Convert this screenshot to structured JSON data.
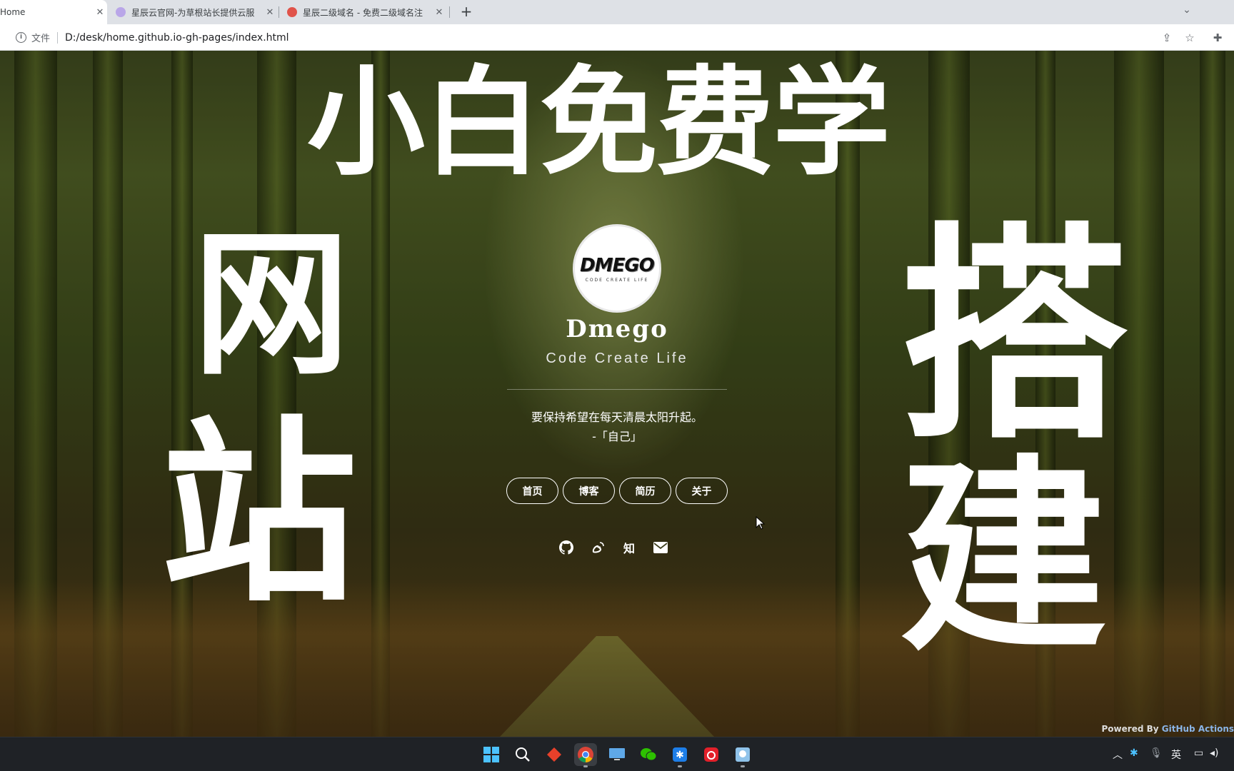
{
  "tabs": [
    {
      "title": "Home",
      "active": true,
      "favicon": "page-icon"
    },
    {
      "title": "星辰云官网-为草根站长提供云服",
      "active": false,
      "favicon": "cloud-icon"
    },
    {
      "title": "星辰二级域名 - 免费二级域名注",
      "active": false,
      "favicon": "logo-icon"
    }
  ],
  "address_bar": {
    "file_label": "文件",
    "url": "D:/desk/home.github.io-gh-pages/index.html"
  },
  "page": {
    "overlay_text": {
      "top": "小白免费学",
      "left_top": "网",
      "left_bottom": "站",
      "right_top": "搭",
      "right_bottom": "建"
    },
    "avatar": {
      "main": "DMEGO",
      "sub": "CODE CREATE LIFE"
    },
    "name": "Dmego",
    "tagline": "Code Create Life",
    "quote": "要保持希望在每天清晨太阳升起。",
    "quote_source": "-「自己」",
    "nav": [
      "首页",
      "博客",
      "简历",
      "关于"
    ],
    "social_icons": [
      "github-icon",
      "weibo-icon",
      "zhihu-icon",
      "mail-icon"
    ],
    "zhihu_glyph": "知",
    "powered_by": {
      "prefix": "Powered By",
      "link": "GitHub Actions"
    }
  },
  "taskbar": {
    "apps": [
      "start-icon",
      "search-icon",
      "app-red-icon",
      "chrome-icon",
      "desktop-icon",
      "wechat-icon",
      "app-blue-icon",
      "netease-music-icon",
      "app-image-icon"
    ],
    "ime": "英"
  },
  "colors": {
    "accent_link": "#8ab4e6",
    "taskbar": "#1f2226",
    "tabbar": "#dee1e6"
  }
}
